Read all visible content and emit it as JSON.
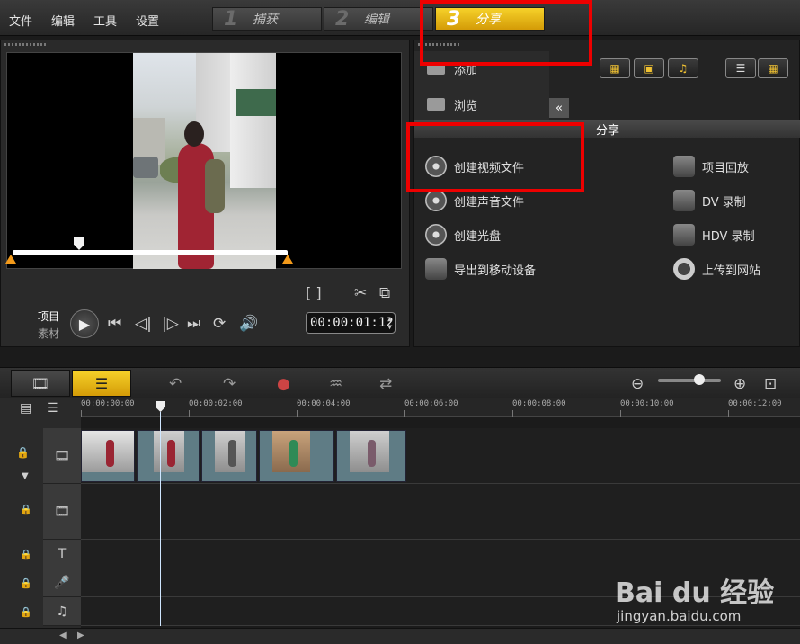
{
  "menu": [
    "文件",
    "编辑",
    "工具",
    "设置"
  ],
  "steps": [
    {
      "num": "1",
      "label": "捕获"
    },
    {
      "num": "2",
      "label": "编辑"
    },
    {
      "num": "3",
      "label": "分享"
    }
  ],
  "player": {
    "mode_project": "项目",
    "mode_clip": "素材",
    "timecode": "00:00:01:12",
    "brackets": "[   ]"
  },
  "library": {
    "add_label": "添加",
    "browse_label": "浏览",
    "share_header": "分享",
    "options_left": [
      "创建视频文件",
      "创建声音文件",
      "创建光盘",
      "导出到移动设备"
    ],
    "options_right": [
      "项目回放",
      "DV 录制",
      "HDV 录制",
      "上传到网站"
    ]
  },
  "timeline": {
    "ticks": [
      "00:00:00:00",
      "00:00:02:00",
      "00:00:04:00",
      "00:00:06:00",
      "00:00:08:00",
      "00:00:10:00",
      "00:00:12:00"
    ]
  },
  "watermark": {
    "main": "Bai du 经验",
    "sub": "jingyan.baidu.com"
  },
  "colors": {
    "accent": "#e8b416",
    "highlight_box": "#ee0000"
  }
}
